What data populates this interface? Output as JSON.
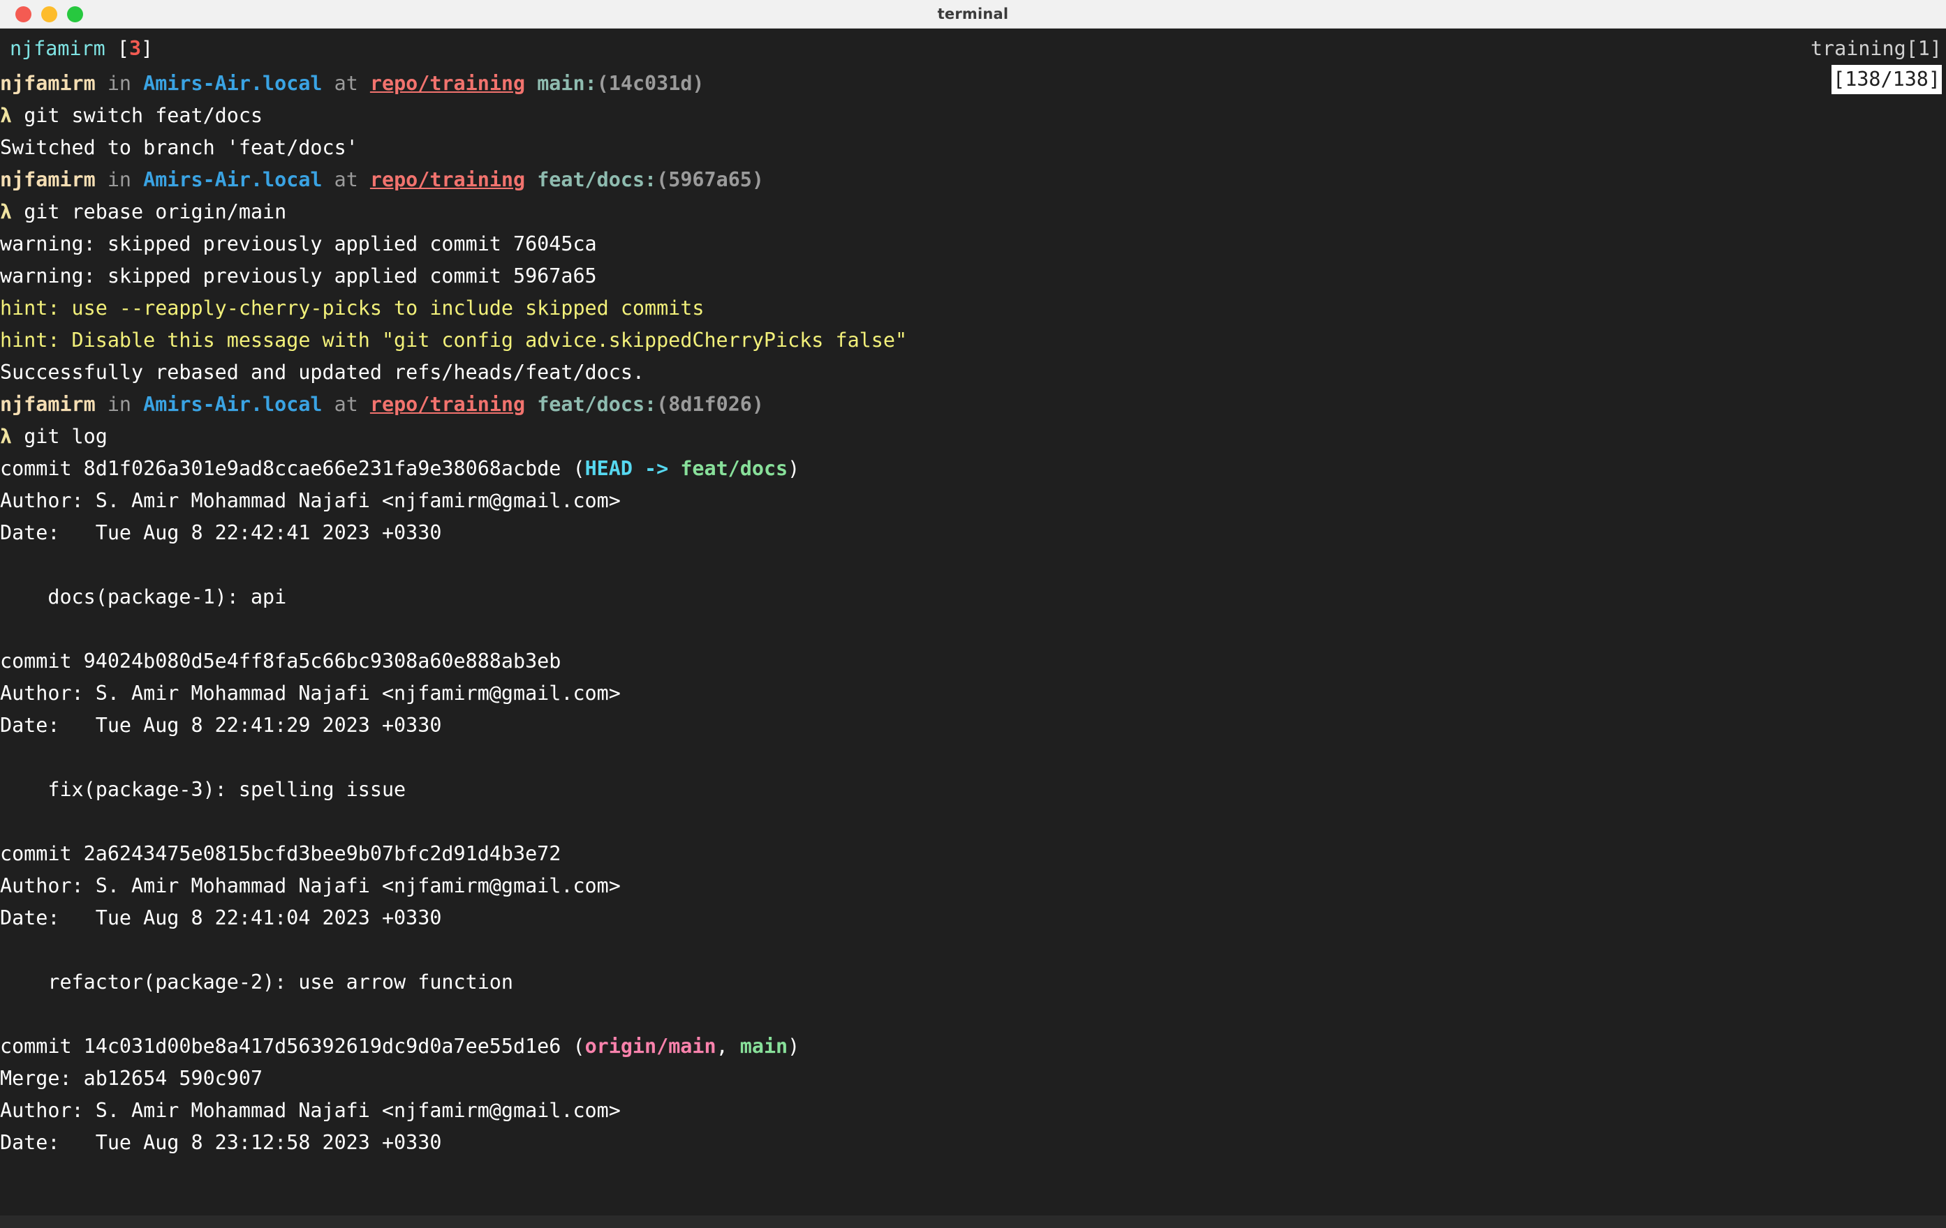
{
  "window": {
    "title": "terminal",
    "traffic_lights": [
      {
        "name": "close",
        "color": "#f45b52"
      },
      {
        "name": "minimize",
        "color": "#fdbc2c"
      },
      {
        "name": "maximize",
        "color": "#27c83f"
      }
    ]
  },
  "status": {
    "session_user": "njfamirm",
    "session_bracket_open": " [",
    "session_index": "3",
    "session_bracket_close": "]",
    "session_name": "training[1]",
    "scroll_position": "[138/138]"
  },
  "colors": {
    "background": "#1f1f1f",
    "titlebar": "#f1f1f1",
    "foreground": "#ffffff",
    "user": "#f5deb3",
    "host": "#3aa3e3",
    "path": "#f2736e",
    "branch": "#8fbcb0",
    "hash": "#9b9b9b",
    "hint": "#f2f07a",
    "head": "#56d8f0",
    "local_ref": "#88e09a",
    "remote_ref": "#f982ac",
    "prompt_symbol": "#f0e3a0",
    "cyan_accent": "#7fe3e3"
  },
  "prompt": {
    "symbol": "λ",
    "user": "njfamirm",
    "word_in": "in",
    "host": "Amirs-Air.local",
    "word_at": "at",
    "path": "repo/training"
  },
  "terminal_lines": [
    {
      "type": "prompt",
      "branch": "main",
      "hash": "(14c031d)"
    },
    {
      "type": "command",
      "text": "git switch feat/docs"
    },
    {
      "type": "output",
      "text": "Switched to branch 'feat/docs'"
    },
    {
      "type": "prompt",
      "branch": "feat/docs",
      "hash": "(5967a65)"
    },
    {
      "type": "command",
      "text": "git rebase origin/main"
    },
    {
      "type": "output",
      "text": "warning: skipped previously applied commit 76045ca"
    },
    {
      "type": "output",
      "text": "warning: skipped previously applied commit 5967a65"
    },
    {
      "type": "hint",
      "text": "hint: use --reapply-cherry-picks to include skipped commits"
    },
    {
      "type": "hint",
      "text": "hint: Disable this message with \"git config advice.skippedCherryPicks false\""
    },
    {
      "type": "output",
      "text": "Successfully rebased and updated refs/heads/feat/docs."
    },
    {
      "type": "prompt",
      "branch": "feat/docs",
      "hash": "(8d1f026)"
    },
    {
      "type": "command",
      "text": "git log"
    },
    {
      "type": "commit",
      "label": "commit ",
      "sha": "8d1f026a301e9ad8ccae66e231fa9e38068acbde",
      "refs_open": " (",
      "refs": [
        {
          "text": "HEAD",
          "kind": "head"
        },
        {
          "text": " -> ",
          "kind": "head"
        },
        {
          "text": "feat/docs",
          "kind": "local"
        }
      ],
      "refs_close": ")"
    },
    {
      "type": "output",
      "text": "Author: S. Amir Mohammad Najafi <njfamirm@gmail.com>"
    },
    {
      "type": "output",
      "text": "Date:   Tue Aug 8 22:42:41 2023 +0330"
    },
    {
      "type": "blank",
      "text": ""
    },
    {
      "type": "output",
      "text": "    docs(package-1): api"
    },
    {
      "type": "blank",
      "text": ""
    },
    {
      "type": "commit",
      "label": "commit ",
      "sha": "94024b080d5e4ff8fa5c66bc9308a60e888ab3eb",
      "refs_open": "",
      "refs": [],
      "refs_close": ""
    },
    {
      "type": "output",
      "text": "Author: S. Amir Mohammad Najafi <njfamirm@gmail.com>"
    },
    {
      "type": "output",
      "text": "Date:   Tue Aug 8 22:41:29 2023 +0330"
    },
    {
      "type": "blank",
      "text": ""
    },
    {
      "type": "output",
      "text": "    fix(package-3): spelling issue"
    },
    {
      "type": "blank",
      "text": ""
    },
    {
      "type": "commit",
      "label": "commit ",
      "sha": "2a6243475e0815bcfd3bee9b07bfc2d91d4b3e72",
      "refs_open": "",
      "refs": [],
      "refs_close": ""
    },
    {
      "type": "output",
      "text": "Author: S. Amir Mohammad Najafi <njfamirm@gmail.com>"
    },
    {
      "type": "output",
      "text": "Date:   Tue Aug 8 22:41:04 2023 +0330"
    },
    {
      "type": "blank",
      "text": ""
    },
    {
      "type": "output",
      "text": "    refactor(package-2): use arrow function"
    },
    {
      "type": "blank",
      "text": ""
    },
    {
      "type": "commit",
      "label": "commit ",
      "sha": "14c031d00be8a417d56392619dc9d0a7ee55d1e6",
      "refs_open": " (",
      "refs": [
        {
          "text": "origin/main",
          "kind": "remote"
        },
        {
          "text": ", ",
          "kind": "plain"
        },
        {
          "text": "main",
          "kind": "local"
        }
      ],
      "refs_close": ")"
    },
    {
      "type": "output",
      "text": "Merge: ab12654 590c907"
    },
    {
      "type": "output",
      "text": "Author: S. Amir Mohammad Najafi <njfamirm@gmail.com>"
    },
    {
      "type": "output",
      "text": "Date:   Tue Aug 8 23:12:58 2023 +0330"
    }
  ]
}
